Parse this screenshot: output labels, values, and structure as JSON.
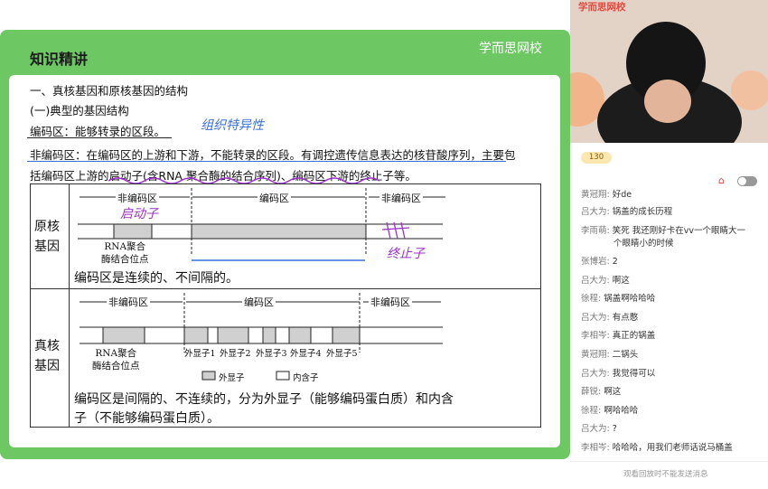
{
  "slide": {
    "brand": "学而思网校",
    "title": "知识精讲",
    "heading1": "一、真核基因和原核基因的结构",
    "heading2": "(一)典型的基因结构",
    "coding_def": "编码区：能够转录的区段。",
    "noncoding_def_line1": "非编码区：在编码区的上游和下游，不能转录的区段。有调控遗传信息表达的核苷酸序列，主要包",
    "noncoding_def_line2": "括编码区上游的启动子(含RNA 聚合酶的结合序列)、编码区下游的终止子等。",
    "handwriting_1": "组织特异性",
    "handwriting_2": "启动子",
    "handwriting_3": "终止子",
    "prokaryote": {
      "label_line1": "原核",
      "label_line2": "基因",
      "region_left": "非编码区",
      "region_mid": "编码区",
      "region_right": "非编码区",
      "rna_label_line1": "RNA聚合",
      "rna_label_line2": "酶结合位点",
      "note": "编码区是连续的、不间隔的。"
    },
    "eukaryote": {
      "label_line1": "真核",
      "label_line2": "基因",
      "region_left": "非编码区",
      "region_mid": "编码区",
      "region_right": "非编码区",
      "rna_label_line1": "RNA聚合",
      "rna_label_line2": "酶结合位点",
      "exons": [
        "外显子1",
        "外显子2",
        "外显子3",
        "外显子4",
        "外显子5"
      ],
      "legend_exon": "外显子",
      "legend_intron": "内含子",
      "note_line1": "编码区是间隔的、不连续的，分为外显子（能够编码蛋白质）和内含",
      "note_line2": "子（不能够编码蛋白质）。"
    }
  },
  "video": {
    "brand": "学而思网校"
  },
  "chat": {
    "like_count": "130",
    "messages": [
      {
        "name": "黄冠翔:",
        "text": "好de"
      },
      {
        "name": "吕大为:",
        "text": "锅盖的成长历程"
      },
      {
        "name": "李雨萌:",
        "text": "笑死 我还刚好卡在vv一个眼睛大一"
      },
      {
        "name": "",
        "text": "个眼睛小的时候"
      },
      {
        "name": "张博岩:",
        "text": "2"
      },
      {
        "name": "吕大为:",
        "text": "啊这"
      },
      {
        "name": "徐程:",
        "text": "锅盖啊哈哈哈"
      },
      {
        "name": "吕大为:",
        "text": "有点憨"
      },
      {
        "name": "李相岑:",
        "text": "真正的锅盖"
      },
      {
        "name": "黄冠翔:",
        "text": "二锅头"
      },
      {
        "name": "吕大为:",
        "text": "我觉得可以"
      },
      {
        "name": "薛锐:",
        "text": "啊这"
      },
      {
        "name": "徐程:",
        "text": "啊哈哈哈"
      },
      {
        "name": "吕大为:",
        "text": "?"
      },
      {
        "name": "李相岑:",
        "text": "哈哈哈，用我们老师话说马桶盖"
      }
    ],
    "footer": "观看回放时不能发送消息"
  },
  "colors": {
    "frame_green": "#6dc763",
    "ink_purple": "#9b30c8",
    "ink_blue": "#3a6fd8",
    "exon_gray": "#d0d0d0"
  }
}
